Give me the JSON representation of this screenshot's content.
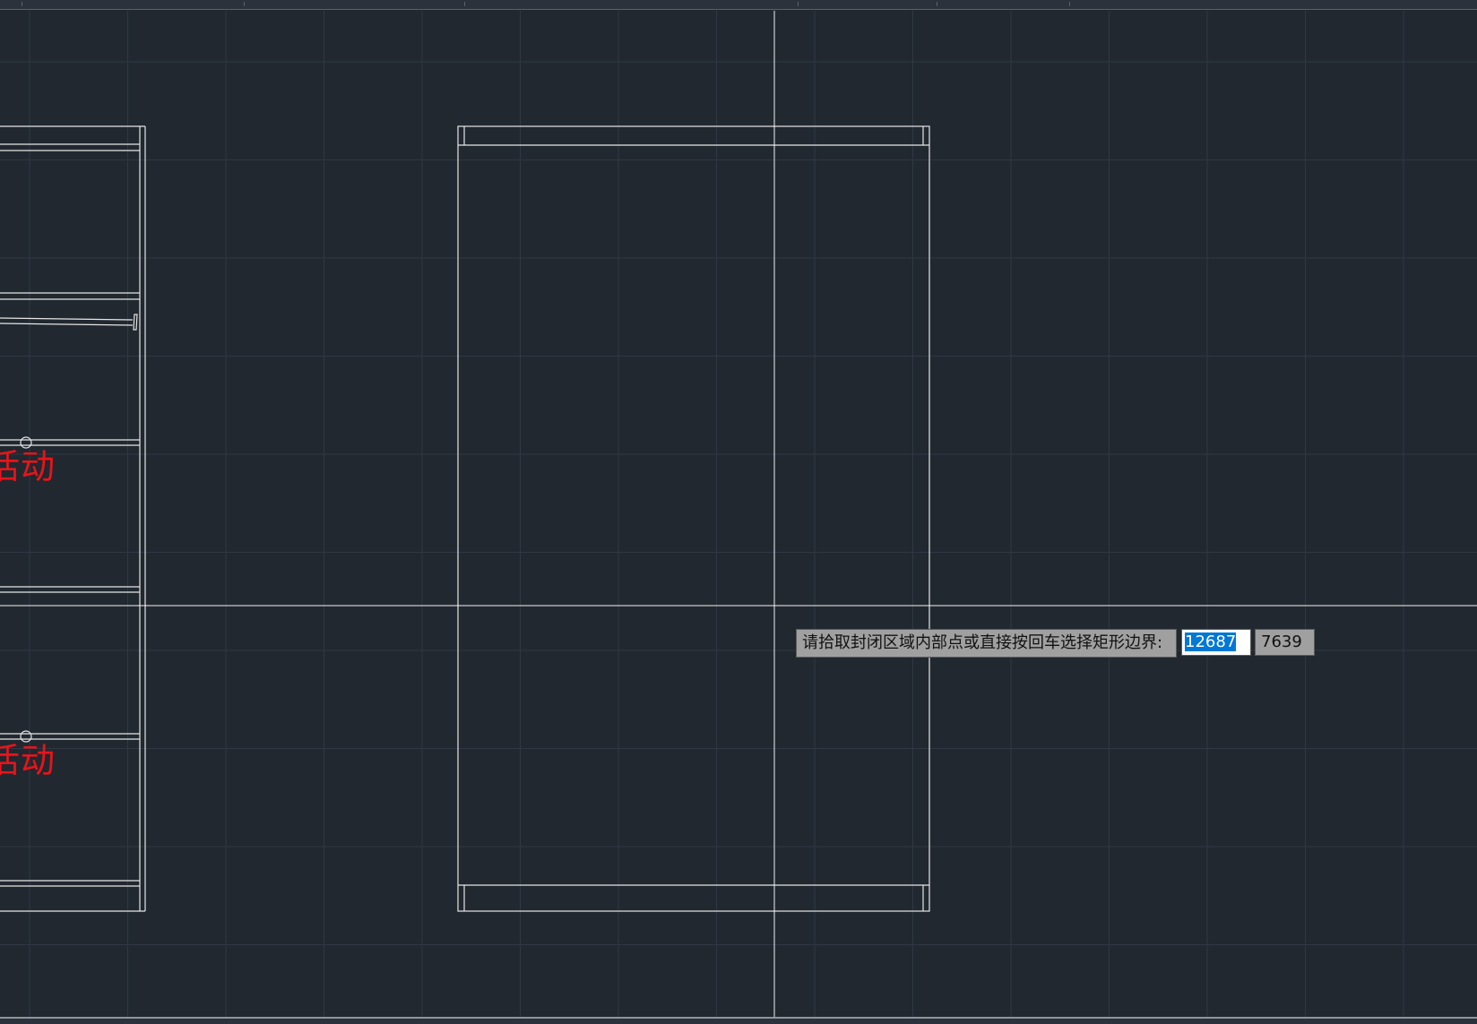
{
  "canvas": {
    "background": "#212830",
    "grid_color": "#2f3844",
    "line_color": "#e6e6e6",
    "text_color": "#e8141a"
  },
  "drawing_labels": [
    {
      "text": "活动"
    },
    {
      "text": "活动"
    }
  ],
  "command_prompt": {
    "text": "请拾取封闭区域内部点或直接按回车选择矩形边界:",
    "x_value": "12687",
    "y_value": "7639"
  }
}
